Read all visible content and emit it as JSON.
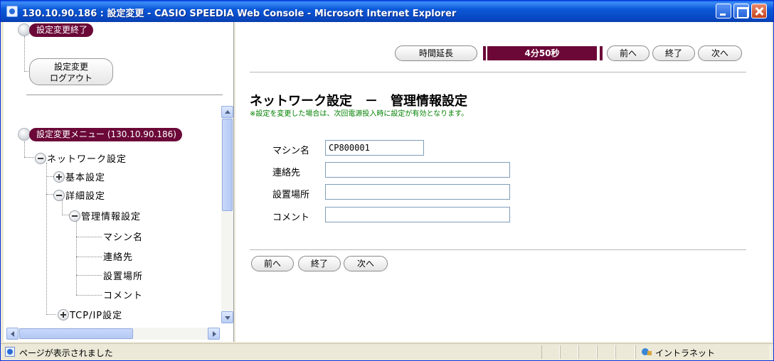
{
  "window": {
    "title": "130.10.90.186 : 設定変更 - CASIO SPEEDIA Web Console - Microsoft Internet Explorer"
  },
  "left": {
    "end_label": "設定変更終了",
    "logout_line1": "設定変更",
    "logout_line2": "ログアウト",
    "menu_header": "設定変更メニュー (130.10.90.186)",
    "tree": {
      "network": "ネットワーク設定",
      "basic": "基本設定",
      "detail": "詳細設定",
      "mgmt": "管理情報設定",
      "machine": "マシン名",
      "contact": "連絡先",
      "location": "設置場所",
      "comment": "コメント",
      "tcpip": "TCP/IP設定"
    }
  },
  "right": {
    "extend_label": "時間延長",
    "timer": "4分50秒",
    "prev": "前へ",
    "end": "終了",
    "next": "次へ",
    "title": "ネットワーク設定　－　管理情報設定",
    "note": "※設定を変更した場合は、次回電源投入時に設定が有効となります。",
    "fields": {
      "machine_label": "マシン名",
      "machine_value": "CP800001",
      "contact_label": "連絡先",
      "contact_value": "",
      "location_label": "設置場所",
      "location_value": "",
      "comment_label": "コメント",
      "comment_value": ""
    }
  },
  "status": {
    "text": "ページが表示されました",
    "zone": "イントラネット"
  }
}
